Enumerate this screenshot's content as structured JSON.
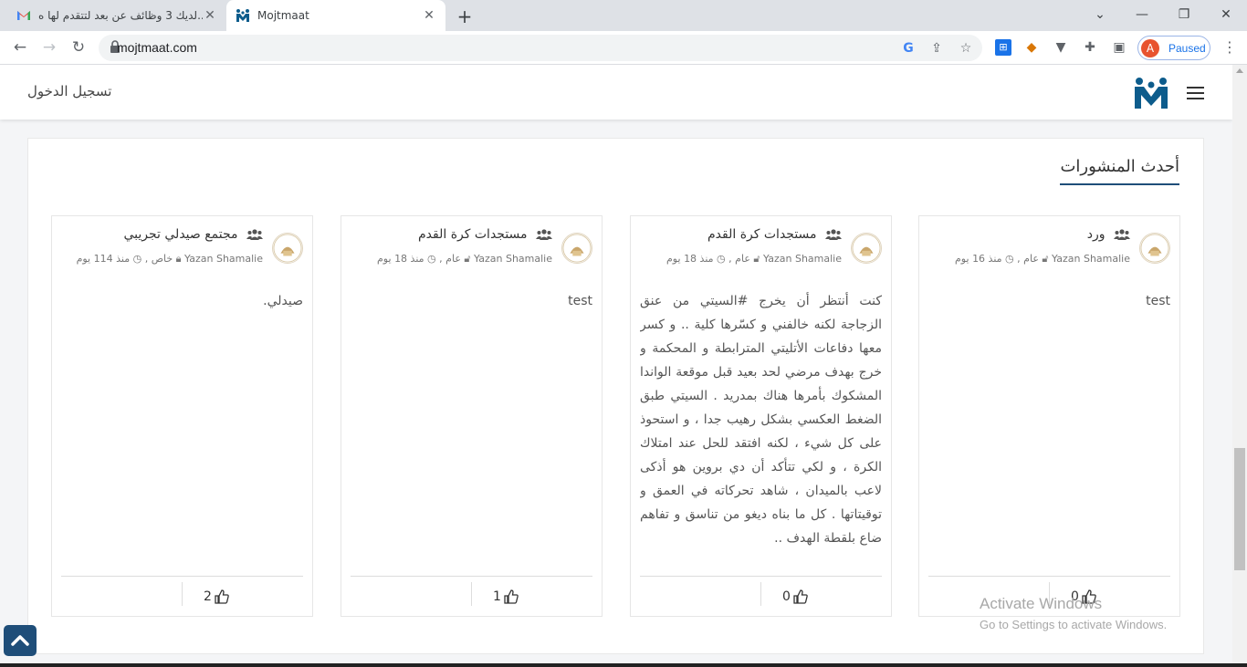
{
  "browser": {
    "tabs": [
      {
        "title": "لديك 3 وظائف عن بعد لتتقدم لها ه..."
      },
      {
        "title": "Mojtmaat"
      }
    ],
    "url": "mojtmaat.com",
    "profile_label": "Paused",
    "profile_initial": "A"
  },
  "header": {
    "login_label": "تسجيل الدخول"
  },
  "section": {
    "title": "أحدث المنشورات"
  },
  "cards": [
    {
      "group": "ورد",
      "author": "Yazan Shamalie",
      "privacy": "عام",
      "time": "منذ 16 يوم",
      "body": "test",
      "likes": "0"
    },
    {
      "group": "مستجدات كرة القدم",
      "author": "Yazan Shamalie",
      "privacy": "عام",
      "time": "منذ 18 يوم",
      "body": "كنت أنتظر أن يخرج #السيتي من عنق الزجاجة لكنه خالفني و كسّرها كلية .. و كسر معها دفاعات الأتليتي المترابطة و المحكمة و خرج بهدف مرضي لحد بعيد قبل موقعة الواندا المشكوك بأمرها هناك بمدريد . السيتي طبق الضغط العكسي بشكل رهيب جدا ، و استحوذ على كل شيء ، لكنه افتقد للحل عند امتلاك الكرة ، و لكي تتأكد أن دي بروين هو أذكى لاعب بالميدان ، شاهد تحركاته في العمق و توقيتاتها . كل ما بناه ديغو من تناسق و تفاهم ضاع بلقطة الهدف ..",
      "likes": "0"
    },
    {
      "group": "مستجدات كرة القدم",
      "author": "Yazan Shamalie",
      "privacy": "عام",
      "time": "منذ 18 يوم",
      "body": "test",
      "likes": "1"
    },
    {
      "group": "مجتمع صيدلي تجريبي",
      "author": "Yazan Shamalie",
      "privacy": "خاص",
      "time": "منذ 114 يوم",
      "body": "صيدلي.",
      "likes": "2"
    }
  ],
  "watermark": {
    "line1": "Activate Windows",
    "line2": "Go to Settings to activate Windows."
  },
  "colors": {
    "brand": "#1f4e79",
    "logo": "#0d5c8c"
  }
}
